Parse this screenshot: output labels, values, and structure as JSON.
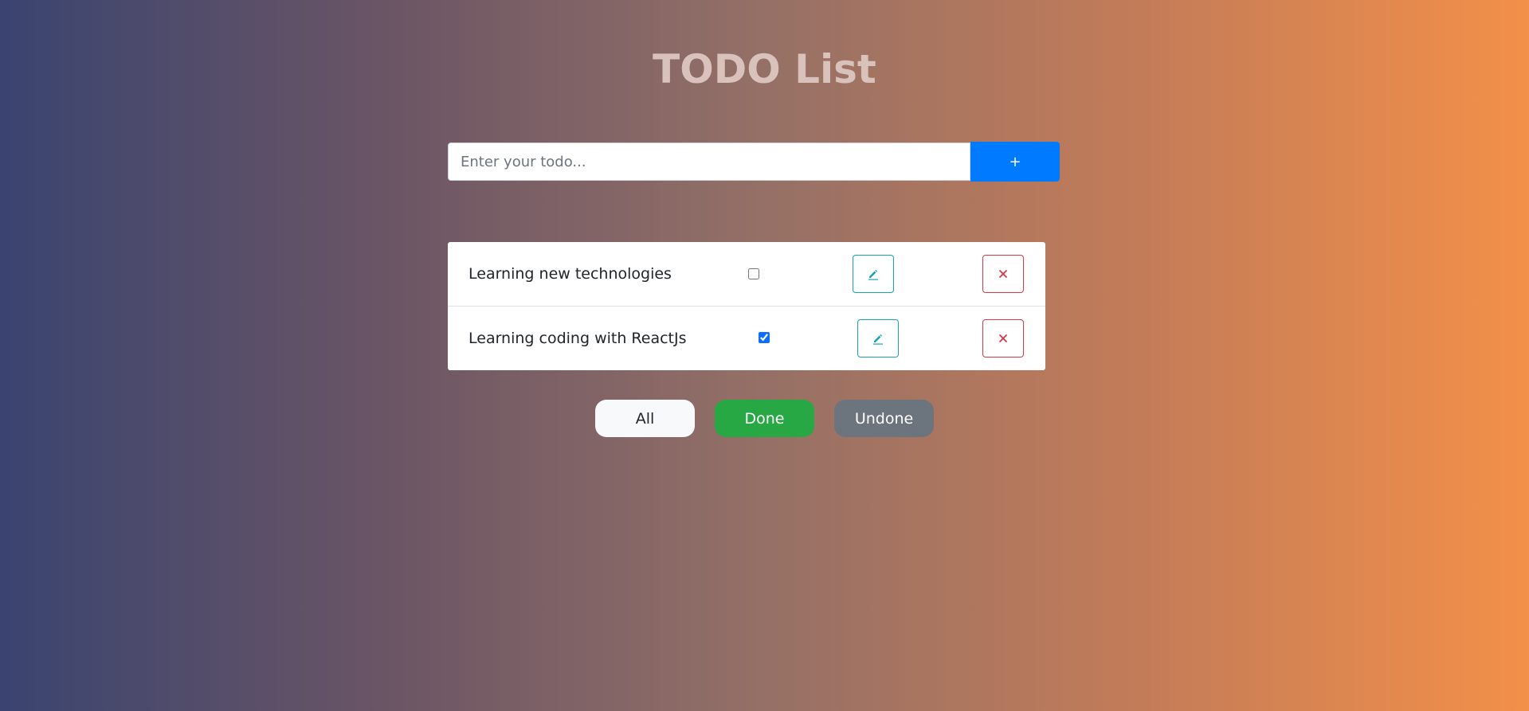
{
  "header": {
    "title": "TODO List"
  },
  "form": {
    "input_value": "",
    "input_placeholder": "Enter your todo...",
    "add_label": "+"
  },
  "todos": [
    {
      "text": "Learning new technologies",
      "done": false
    },
    {
      "text": "Learning coding with ReactJs",
      "done": true
    }
  ],
  "icons": {
    "edit": "pencil-icon",
    "delete": "close-icon"
  },
  "filters": {
    "all": "All",
    "done": "Done",
    "undone": "Undone"
  },
  "colors": {
    "primary": "#007bff",
    "info": "#17a2b8",
    "danger": "#dc3545",
    "success": "#28a745",
    "secondary": "#6c757d",
    "light": "#f8f9fa"
  }
}
